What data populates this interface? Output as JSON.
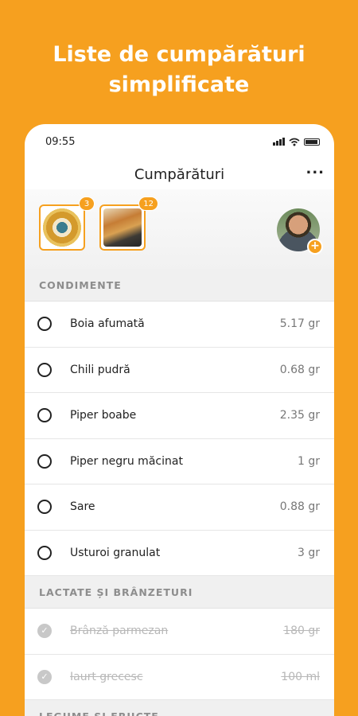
{
  "headline": {
    "line1": "Liste de cumpărături",
    "line2": "simplificate"
  },
  "status_bar": {
    "time": "09:55"
  },
  "nav": {
    "title": "Cumpărături",
    "more_label": "..."
  },
  "recipes": [
    {
      "badge": "3"
    },
    {
      "badge": "12"
    }
  ],
  "avatar": {
    "add_label": "+"
  },
  "sections": [
    {
      "title": "CONDIMENTE",
      "items": [
        {
          "name": "Boia afumată",
          "qty": "5.17 gr",
          "checked": false
        },
        {
          "name": "Chili pudră",
          "qty": "0.68 gr",
          "checked": false
        },
        {
          "name": "Piper boabe",
          "qty": "2.35 gr",
          "checked": false
        },
        {
          "name": "Piper negru măcinat",
          "qty": "1 gr",
          "checked": false
        },
        {
          "name": "Sare",
          "qty": "0.88 gr",
          "checked": false
        },
        {
          "name": "Usturoi granulat",
          "qty": "3 gr",
          "checked": false
        }
      ]
    },
    {
      "title": "LACTATE ȘI BRÂNZETURI",
      "items": [
        {
          "name": "Brânză parmezan",
          "qty": "180 gr",
          "checked": true
        },
        {
          "name": "Iaurt grecesc",
          "qty": "100 ml",
          "checked": true
        }
      ]
    },
    {
      "title": "LEGUME ȘI FRUCTE",
      "items": []
    }
  ],
  "colors": {
    "accent": "#F6A01F",
    "checked": "#c8c8c8"
  }
}
